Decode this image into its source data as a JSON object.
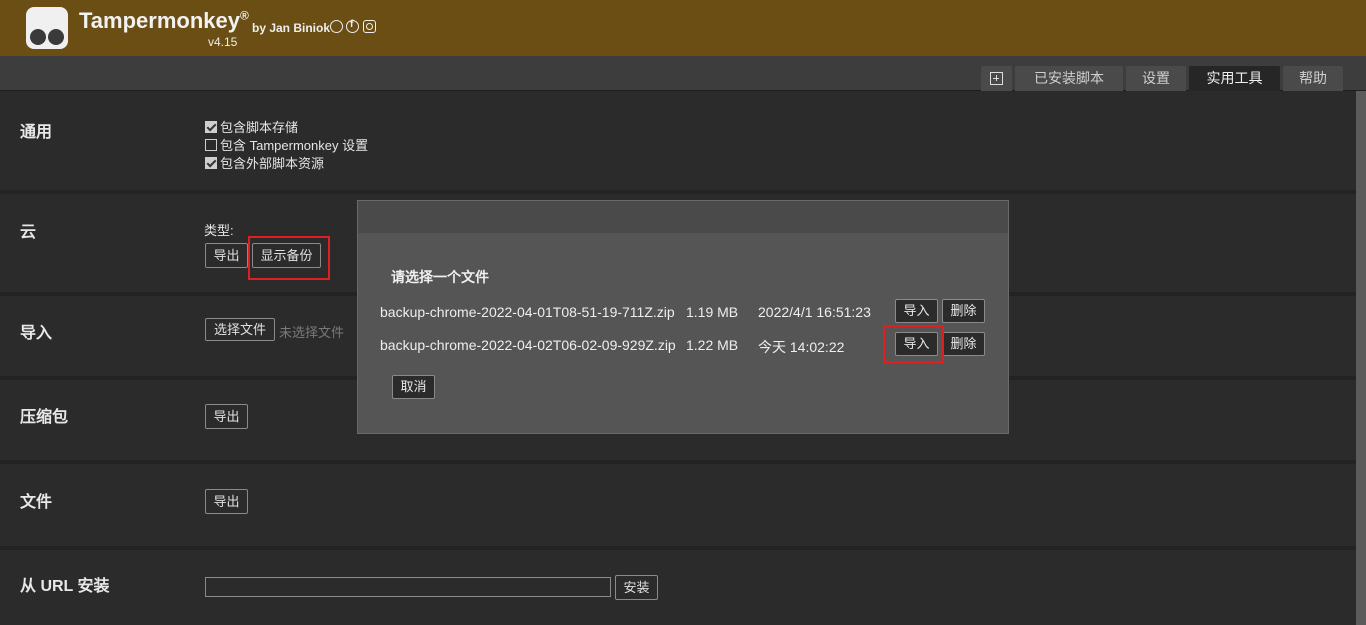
{
  "header": {
    "app_name": "Tampermonkey",
    "registered": "®",
    "version": "v4.15",
    "byline": "by Jan Biniok",
    "social_icons": [
      "github-icon",
      "facebook-icon",
      "instagram-icon"
    ],
    "background_color": "#6b4e13"
  },
  "tabs": [
    {
      "label": "已安装脚本",
      "active": false
    },
    {
      "label": "设置",
      "active": false
    },
    {
      "label": "实用工具",
      "active": true
    },
    {
      "label": "帮助",
      "active": false
    }
  ],
  "sections": {
    "general": {
      "title": "通用",
      "checkboxes": [
        {
          "label": "包含脚本存储",
          "checked": true
        },
        {
          "label": "包含 Tampermonkey 设置",
          "checked": false
        },
        {
          "label": "包含外部脚本资源",
          "checked": true
        }
      ]
    },
    "cloud": {
      "title": "云",
      "type_label": "类型:",
      "export_label": "导出",
      "show_backups_label": "显示备份"
    },
    "import": {
      "title": "导入",
      "choose_file_label": "选择文件",
      "no_file_label": "未选择文件"
    },
    "zip": {
      "title": "压缩包",
      "export_label": "导出"
    },
    "file": {
      "title": "文件",
      "export_label": "导出"
    },
    "url_install": {
      "title": "从 URL 安装",
      "input_value": "",
      "install_label": "安装"
    }
  },
  "modal": {
    "title": "请选择一个文件",
    "files": [
      {
        "name": "backup-chrome-2022-04-01T08-51-19-711Z.zip",
        "size": "1.19 MB",
        "date": "2022/4/1 16:51:23",
        "import_label": "导入",
        "delete_label": "删除"
      },
      {
        "name": "backup-chrome-2022-04-02T06-02-09-929Z.zip",
        "size": "1.22 MB",
        "date": "今天 14:02:22",
        "import_label": "导入",
        "delete_label": "删除"
      }
    ],
    "cancel_label": "取消"
  },
  "highlight_color": "#e02020"
}
